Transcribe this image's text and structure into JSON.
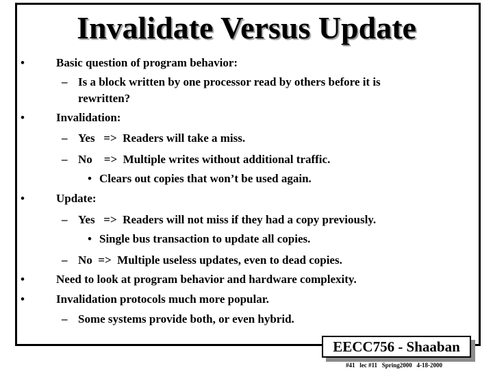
{
  "slide": {
    "title": "Invalidate Versus Update",
    "lines": [
      {
        "level": 1,
        "marker": "•",
        "text": "Basic question of program behavior:"
      },
      {
        "level": 2,
        "marker": "–",
        "text": "Is a block written by one processor read by others before it is"
      },
      {
        "level": 2,
        "marker": "",
        "text": "rewritten?"
      },
      {
        "level": 1,
        "marker": "•",
        "text": "Invalidation:"
      },
      {
        "level": 2,
        "marker": "–",
        "text": "Yes   =>  Readers will take a miss."
      },
      {
        "level": 2,
        "marker": "–",
        "text": "No    =>  Multiple writes without additional traffic."
      },
      {
        "level": 3,
        "marker": "•",
        "text": "Clears out copies that won’t be used again."
      },
      {
        "level": 1,
        "marker": "•",
        "text": "Update:"
      },
      {
        "level": 2,
        "marker": "–",
        "text": "Yes   =>  Readers will not miss if they had a copy previously."
      },
      {
        "level": 3,
        "marker": "•",
        "text": "Single bus transaction to update all copies."
      },
      {
        "level": 2,
        "marker": "–",
        "text": "No  =>  Multiple useless updates, even to dead copies."
      },
      {
        "level": 1,
        "marker": "•",
        "text": "Need to look at program behavior and hardware complexity."
      },
      {
        "level": 1,
        "marker": "•",
        "text": "Invalidation protocols much more popular."
      },
      {
        "level": 2,
        "marker": "–",
        "text": "Some systems provide both, or even hybrid."
      }
    ]
  },
  "footer": {
    "course": "EECC756 - Shaaban",
    "info": "#41   lec #11   Spring2000   4-18-2000"
  }
}
